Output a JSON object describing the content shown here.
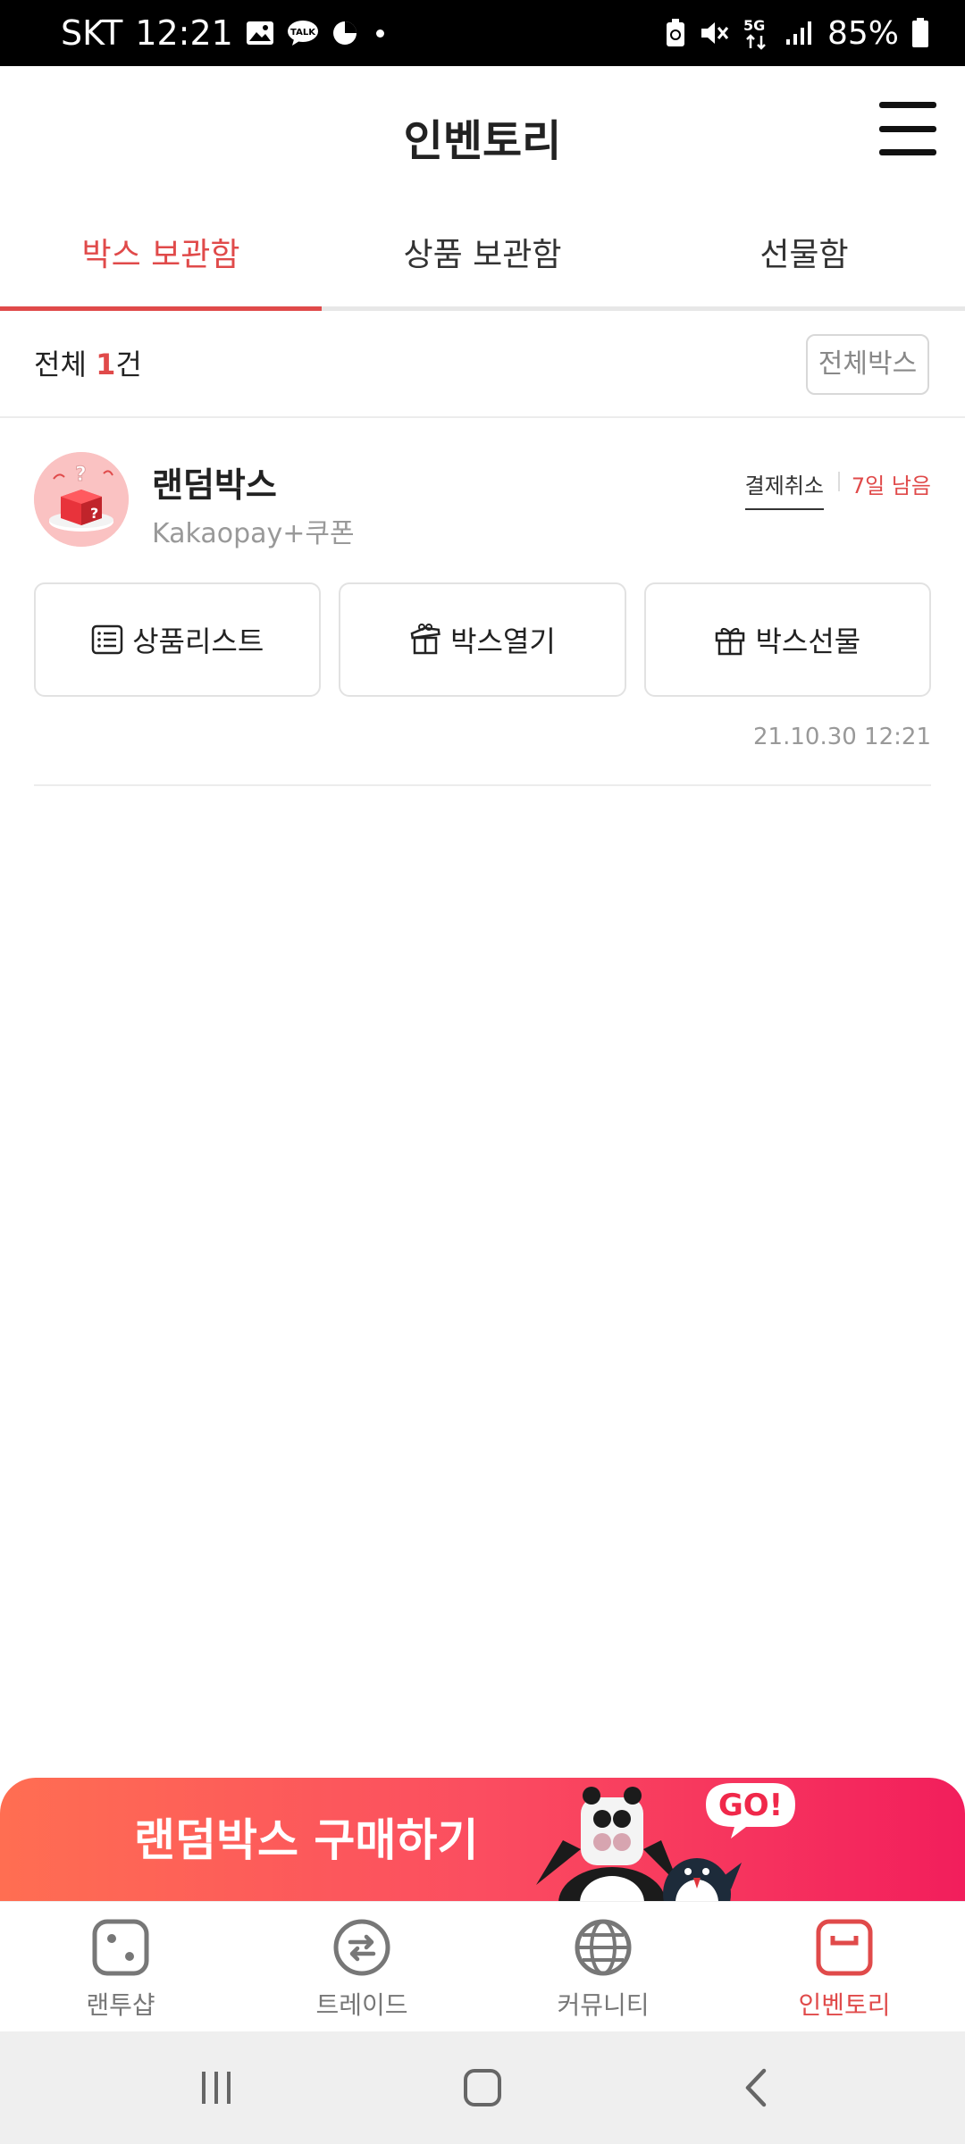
{
  "status_bar": {
    "carrier": "SKT",
    "time": "12:21",
    "battery": "85%",
    "network": "5G",
    "notification_icons": [
      "gallery-icon",
      "kakaotalk-icon",
      "pie-icon"
    ],
    "system_icons": [
      "battery-saver-icon",
      "mute-icon",
      "5g-icon",
      "signal-icon",
      "battery-icon"
    ]
  },
  "header": {
    "title": "인벤토리"
  },
  "tabs": [
    {
      "label": "박스 보관함",
      "active": true
    },
    {
      "label": "상품 보관함",
      "active": false
    },
    {
      "label": "선물함",
      "active": false
    }
  ],
  "summary": {
    "prefix": "전체 ",
    "count": "1",
    "suffix": "건",
    "filter_label": "전체박스"
  },
  "items": [
    {
      "name": "랜덤박스",
      "subtitle": "Kakaopay+쿠폰",
      "cancel_label": "결제취소",
      "days_left": "7일 남음",
      "date": "21.10.30 12:21",
      "actions": [
        {
          "label": "상품리스트",
          "icon": "list-icon"
        },
        {
          "label": "박스열기",
          "icon": "open-box-icon"
        },
        {
          "label": "박스선물",
          "icon": "gift-icon"
        }
      ]
    }
  ],
  "promo": {
    "text": "랜덤박스 구매하기",
    "badge": "GO!"
  },
  "bottom_nav": [
    {
      "label": "랜투샵",
      "icon": "dice-icon",
      "active": false
    },
    {
      "label": "트레이드",
      "icon": "exchange-icon",
      "active": false
    },
    {
      "label": "커뮤니티",
      "icon": "globe-icon",
      "active": false
    },
    {
      "label": "인벤토리",
      "icon": "inventory-box-icon",
      "active": true
    }
  ],
  "colors": {
    "accent": "#e04a4a",
    "promo_start": "#ff6e52",
    "promo_end": "#f21e5c"
  }
}
